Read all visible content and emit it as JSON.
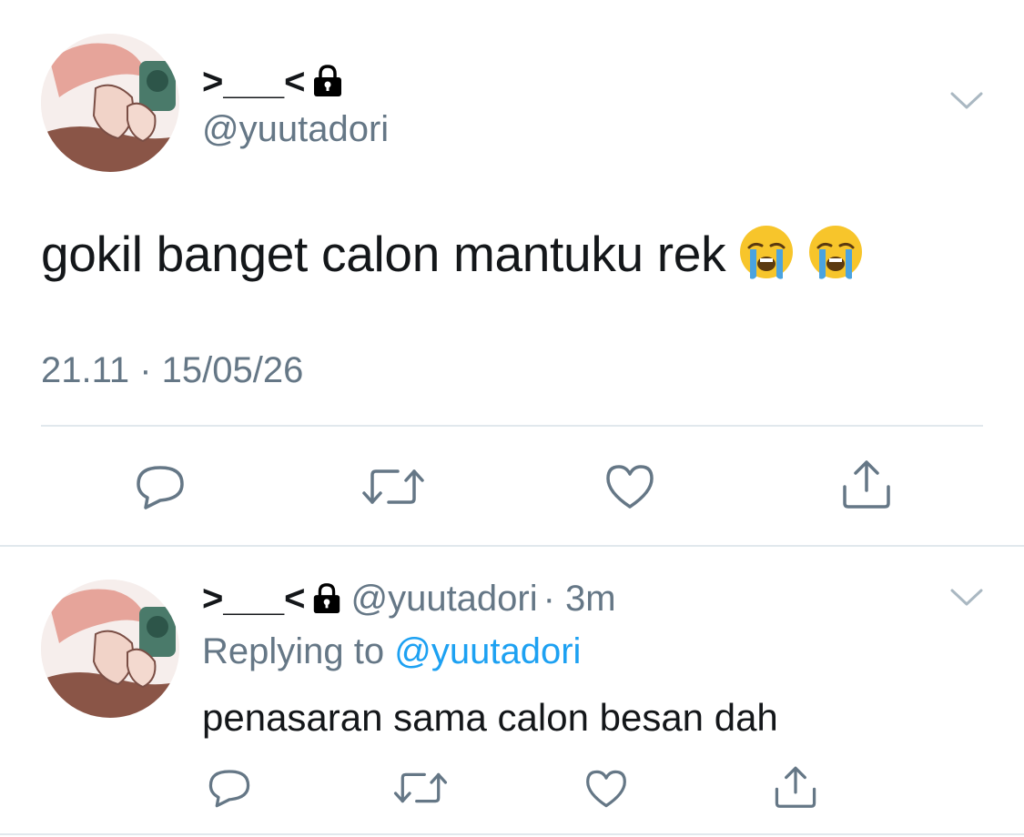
{
  "main_tweet": {
    "display_name": ">___<",
    "handle": "@yuutadori",
    "text": "gokil banget calon mantuku rek",
    "emojis": [
      "loudly-crying-face",
      "loudly-crying-face"
    ],
    "timestamp": "21.11 · 15/05/26"
  },
  "reply_tweet": {
    "display_name": ">___<",
    "handle": "@yuutadori",
    "time_ago": "· 3m",
    "replying_label": "Replying to",
    "replying_to": "@yuutadori",
    "text": "penasaran sama calon besan dah"
  },
  "actions": [
    "reply",
    "retweet",
    "like",
    "share"
  ],
  "colors": {
    "text": "#14171a",
    "secondary": "#657786",
    "link": "#1da1f2",
    "divider": "#e1e8ed",
    "emoji": "#f7c52b"
  }
}
